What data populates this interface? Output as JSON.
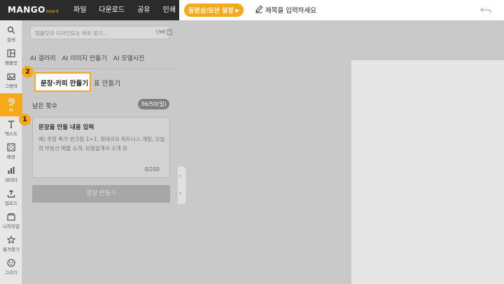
{
  "header": {
    "logo": {
      "main": "MANGO",
      "sub": "board"
    },
    "menu": [
      "파일",
      "다운로드",
      "공유",
      "인쇄"
    ],
    "resize_button": "동영상/모션 설정",
    "title_placeholder": "제목을 입력하세요"
  },
  "iconbar": {
    "items": [
      {
        "label": "검색",
        "icon": "search-icon"
      },
      {
        "label": "템플릿",
        "icon": "template-icon"
      },
      {
        "label": "그림박",
        "icon": "image-icon"
      },
      {
        "label": "AI",
        "icon": "ai-icon"
      },
      {
        "label": "텍스트",
        "icon": "text-icon"
      },
      {
        "label": "배경",
        "icon": "background-icon"
      },
      {
        "label": "데이터",
        "icon": "chart-icon"
      },
      {
        "label": "업로드",
        "icon": "upload-icon"
      },
      {
        "label": "나의작업",
        "icon": "folder-icon"
      },
      {
        "label": "즐겨찾기",
        "icon": "star-icon"
      },
      {
        "label": "그리기",
        "icon": "draw-icon"
      }
    ]
  },
  "panel": {
    "search_placeholder": "템플릿과 디자인요소 바로 찾기...",
    "detail_label": "상세",
    "ai_tabs": [
      "AI 갤러리",
      "AI 이미지 만들기",
      "AI 모델사진"
    ],
    "subtabs": {
      "active": "문장·카피 만들기",
      "other": "표 만들기"
    },
    "remaining_label": "남은 횟수",
    "remaining_value": "36/50(일)",
    "input_title": "문장을 만들 내용 입력",
    "input_placeholder": "예) 주말 특가 썬크림 1+1, 최대규모 피트니스 개장, 오늘의 부동산 매물 소개, 보험설계사 소개 등",
    "char_count": "0/200",
    "generate_button": "문장 만들기"
  },
  "markers": [
    "1",
    "2"
  ],
  "colors": {
    "accent": "#f7a81b",
    "topbar": "#2b2b2b"
  }
}
